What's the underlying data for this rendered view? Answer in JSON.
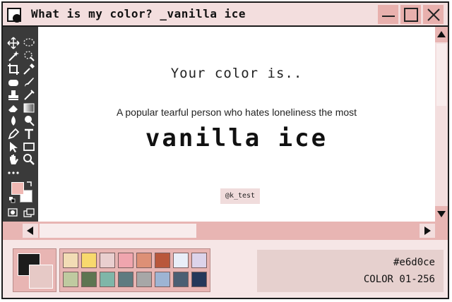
{
  "window": {
    "title": "What is my color? _vanilla ice"
  },
  "result": {
    "heading": "Your color is..",
    "description": "A popular tearful person who hates loneliness the most",
    "color_name": "vanilla ice",
    "credit": "@k_test"
  },
  "color_info": {
    "hex": "#e6d0ce",
    "range": "COLOR 01-256"
  },
  "colors": {
    "accent": "#e8b5b3",
    "foreground_swatch": "#f0b8b3",
    "result_color": "#e6d0ce"
  },
  "palette": [
    "#f2dcb5",
    "#f8d96d",
    "#e9cfcf",
    "#f0a5ae",
    "#dd9076",
    "#b9573b",
    "#e9eef8",
    "#dcd3ea",
    "#bfcaa0",
    "#5e7551",
    "#7fb6a8",
    "#5f7b80",
    "#a7a7a7",
    "#9db4d3",
    "#4b5f73",
    "#25385a"
  ],
  "tools": [
    "move-icon",
    "lasso-icon",
    "magic-wand-icon",
    "quick-select-icon",
    "crop-icon",
    "eyedropper-icon",
    "patch-icon",
    "brush-icon",
    "stamp-icon",
    "history-brush-icon",
    "eraser-icon",
    "gradient-icon",
    "blur-icon",
    "dodge-icon",
    "pen-icon",
    "text-icon",
    "path-select-icon",
    "rectangle-icon",
    "hand-icon",
    "zoom-icon",
    "more-tools-icon"
  ]
}
